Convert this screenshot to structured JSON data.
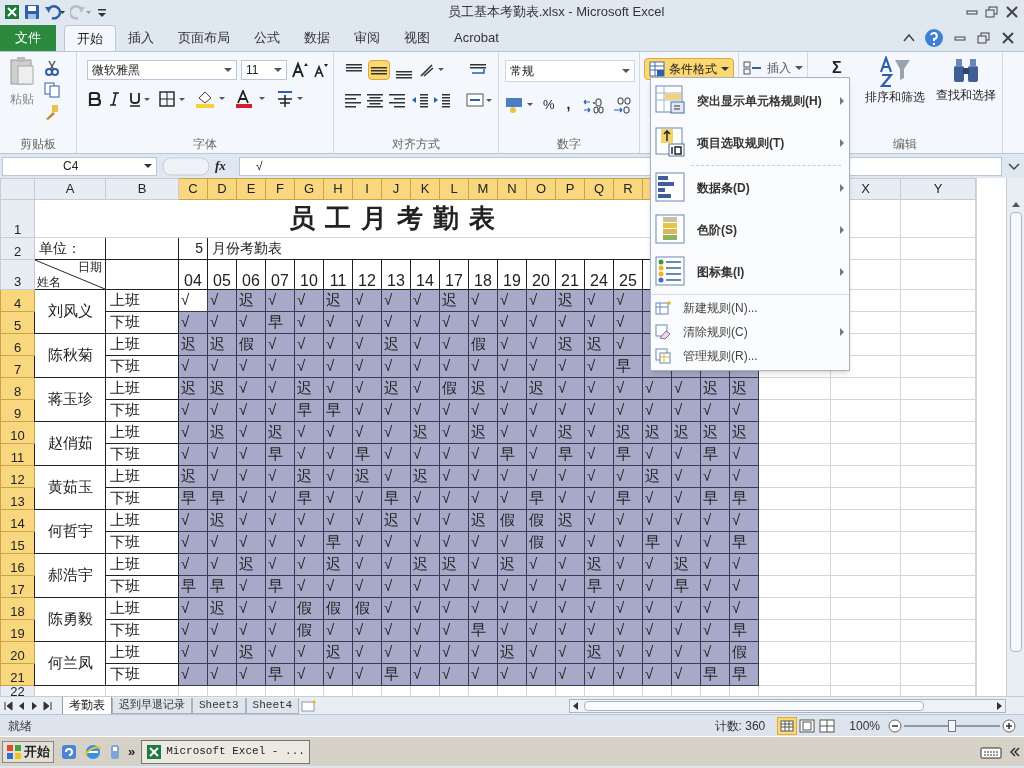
{
  "title_bar": {
    "title": "员工基本考勤表.xlsx - Microsoft Excel"
  },
  "ribbon_tabs": [
    {
      "label": "文件",
      "kind": "file",
      "selected": false
    },
    {
      "label": "开始",
      "kind": "tab",
      "selected": true
    },
    {
      "label": "插入",
      "kind": "tab",
      "selected": false
    },
    {
      "label": "页面布局",
      "kind": "tab",
      "selected": false
    },
    {
      "label": "公式",
      "kind": "tab",
      "selected": false
    },
    {
      "label": "数据",
      "kind": "tab",
      "selected": false
    },
    {
      "label": "审阅",
      "kind": "tab",
      "selected": false
    },
    {
      "label": "视图",
      "kind": "tab",
      "selected": false
    },
    {
      "label": "Acrobat",
      "kind": "tab",
      "selected": false
    }
  ],
  "ribbon": {
    "clipboard": {
      "paste": "粘贴",
      "group": "剪贴板"
    },
    "font": {
      "name": "微软雅黑",
      "size": "11",
      "group": "字体"
    },
    "alignment": {
      "group": "对齐方式"
    },
    "number": {
      "format": "常规",
      "group": "数字",
      "percent": "%",
      "comma": ","
    },
    "conditional_format": "条件格式",
    "insert": "插入",
    "sum": "Σ",
    "editing": {
      "sort": "排序和筛选",
      "find": "查找和选择",
      "group": "编辑"
    }
  },
  "formula_bar": {
    "name_box": "C4",
    "fx": "fx",
    "formula": "√"
  },
  "columns": [
    {
      "label": "A",
      "selected": false
    },
    {
      "label": "B",
      "selected": false
    },
    {
      "label": "C",
      "selected": true
    },
    {
      "label": "D",
      "selected": true
    },
    {
      "label": "E",
      "selected": true
    },
    {
      "label": "F",
      "selected": true
    },
    {
      "label": "G",
      "selected": true
    },
    {
      "label": "H",
      "selected": true
    },
    {
      "label": "I",
      "selected": true
    },
    {
      "label": "J",
      "selected": true
    },
    {
      "label": "K",
      "selected": true
    },
    {
      "label": "L",
      "selected": true
    },
    {
      "label": "M",
      "selected": true
    },
    {
      "label": "N",
      "selected": true
    },
    {
      "label": "O",
      "selected": true
    },
    {
      "label": "P",
      "selected": true
    },
    {
      "label": "Q",
      "selected": true
    },
    {
      "label": "R",
      "selected": true
    }
  ],
  "columns_right": [
    {
      "label": "X",
      "selected": false
    },
    {
      "label": "Y",
      "selected": false
    }
  ],
  "row_headers": [
    {
      "label": "1",
      "selected": false
    },
    {
      "label": "2",
      "selected": false
    },
    {
      "label": "3",
      "selected": false
    },
    {
      "label": "4",
      "selected": true
    },
    {
      "label": "5",
      "selected": true
    },
    {
      "label": "6",
      "selected": true
    },
    {
      "label": "7",
      "selected": true
    },
    {
      "label": "8",
      "selected": true
    },
    {
      "label": "9",
      "selected": true
    },
    {
      "label": "10",
      "selected": true
    },
    {
      "label": "11",
      "selected": true
    },
    {
      "label": "12",
      "selected": true
    },
    {
      "label": "13",
      "selected": true
    },
    {
      "label": "14",
      "selected": true
    },
    {
      "label": "15",
      "selected": true
    },
    {
      "label": "16",
      "selected": true
    },
    {
      "label": "17",
      "selected": true
    },
    {
      "label": "18",
      "selected": true
    },
    {
      "label": "19",
      "selected": true
    },
    {
      "label": "20",
      "selected": true
    },
    {
      "label": "21",
      "selected": true
    },
    {
      "label": "22",
      "selected": false
    }
  ],
  "sheet": {
    "title": "员工月考勤表",
    "unit_label": "单位：",
    "month": "5",
    "month_suffix": "月份考勤表",
    "corner_top": "日期",
    "corner_bottom": "姓名",
    "dates": [
      "04",
      "05",
      "06",
      "07",
      "10",
      "11",
      "12",
      "13",
      "14",
      "17",
      "18",
      "19",
      "20",
      "21",
      "24",
      "25"
    ],
    "employees": [
      {
        "name": "刘风义",
        "shifts": [
          {
            "label": "上班",
            "cells": [
              {
                "text": "√",
                "selected": true
              },
              "√",
              "迟",
              "√",
              "√",
              "迟",
              "√",
              "√",
              "√",
              "迟",
              "√",
              "√",
              "√",
              "迟",
              "√",
              "√"
            ]
          },
          {
            "label": "下班",
            "cells": [
              "√",
              "√",
              "√",
              "早",
              "√",
              "√",
              "√",
              "√",
              "√",
              "√",
              "√",
              "√",
              "√",
              "√",
              "√",
              "√"
            ]
          }
        ]
      },
      {
        "name": "陈秋菊",
        "shifts": [
          {
            "label": "上班",
            "cells": [
              "迟",
              "迟",
              "假",
              "√",
              "√",
              "√",
              "√",
              "迟",
              "√",
              "√",
              "假",
              "√",
              "√",
              "迟",
              "迟",
              "√"
            ]
          },
          {
            "label": "下班",
            "cells": [
              "√",
              "√",
              "√",
              "√",
              "√",
              "√",
              "√",
              "√",
              "√",
              "√",
              "√",
              "√",
              "√",
              "√",
              "√",
              "早"
            ]
          }
        ]
      },
      {
        "name": "蒋玉珍",
        "shifts": [
          {
            "label": "上班",
            "cells": [
              "迟",
              "迟",
              "√",
              "√",
              "迟",
              "√",
              "√",
              "迟",
              "√",
              "假",
              "迟",
              "√",
              "迟",
              "√",
              "√",
              "√",
              "√",
              "√",
              "迟",
              "迟"
            ]
          },
          {
            "label": "下班",
            "cells": [
              "√",
              "√",
              "√",
              "√",
              "早",
              "早",
              "√",
              "√",
              "√",
              "√",
              "√",
              "√",
              "√",
              "√",
              "√",
              "√",
              "√",
              "√",
              "√",
              "√"
            ]
          }
        ]
      },
      {
        "name": "赵俏茹",
        "shifts": [
          {
            "label": "上班",
            "cells": [
              "√",
              "迟",
              "√",
              "迟",
              "√",
              "√",
              "√",
              "√",
              "迟",
              "√",
              "迟",
              "√",
              "√",
              "迟",
              "√",
              "迟",
              "迟",
              "迟",
              "迟",
              "迟"
            ]
          },
          {
            "label": "下班",
            "cells": [
              "√",
              "√",
              "√",
              "早",
              "√",
              "√",
              "早",
              "√",
              "√",
              "√",
              "√",
              "早",
              "√",
              "早",
              "√",
              "早",
              "√",
              "√",
              "早",
              "√"
            ]
          }
        ]
      },
      {
        "name": "黄茹玉",
        "shifts": [
          {
            "label": "上班",
            "cells": [
              "迟",
              "√",
              "√",
              "√",
              "迟",
              "√",
              "迟",
              "√",
              "迟",
              "√",
              "√",
              "√",
              "√",
              "√",
              "√",
              "√",
              "迟",
              "√",
              "√",
              "√"
            ]
          },
          {
            "label": "下班",
            "cells": [
              "早",
              "早",
              "√",
              "√",
              "早",
              "√",
              "√",
              "早",
              "√",
              "√",
              "√",
              "√",
              "早",
              "√",
              "√",
              "早",
              "√",
              "√",
              "早",
              "早"
            ]
          }
        ]
      },
      {
        "name": "何哲宇",
        "shifts": [
          {
            "label": "上班",
            "cells": [
              "√",
              "迟",
              "√",
              "√",
              "√",
              "√",
              "√",
              "迟",
              "√",
              "√",
              "迟",
              "假",
              "假",
              "迟",
              "√",
              "√",
              "√",
              "√",
              "√",
              "√"
            ]
          },
          {
            "label": "下班",
            "cells": [
              "√",
              "√",
              "√",
              "√",
              "√",
              "早",
              "√",
              "√",
              "√",
              "√",
              "√",
              "√",
              "假",
              "√",
              "√",
              "√",
              "早",
              "√",
              "√",
              "早"
            ]
          }
        ]
      },
      {
        "name": "郝浩宇",
        "shifts": [
          {
            "label": "上班",
            "cells": [
              "√",
              "√",
              "迟",
              "√",
              "√",
              "迟",
              "√",
              "√",
              "迟",
              "迟",
              "√",
              "迟",
              "√",
              "√",
              "迟",
              "√",
              "√",
              "迟",
              "√",
              "√"
            ]
          },
          {
            "label": "下班",
            "cells": [
              "早",
              "早",
              "√",
              "早",
              "√",
              "√",
              "√",
              "√",
              "√",
              "√",
              "√",
              "√",
              "√",
              "√",
              "早",
              "√",
              "√",
              "早",
              "√",
              "√"
            ]
          }
        ]
      },
      {
        "name": "陈勇毅",
        "shifts": [
          {
            "label": "上班",
            "cells": [
              "√",
              "迟",
              "√",
              "√",
              "假",
              "假",
              "假",
              "√",
              "√",
              "√",
              "√",
              "√",
              "√",
              "√",
              "√",
              "√",
              "√",
              "√",
              "√",
              "√"
            ]
          },
          {
            "label": "下班",
            "cells": [
              "√",
              "√",
              "√",
              "√",
              "假",
              "√",
              "√",
              "√",
              "√",
              "√",
              "早",
              "√",
              "√",
              "√",
              "√",
              "√",
              "√",
              "√",
              "√",
              "早"
            ]
          }
        ]
      },
      {
        "name": "何兰凤",
        "shifts": [
          {
            "label": "上班",
            "cells": [
              "√",
              "√",
              "迟",
              "√",
              "√",
              "迟",
              "√",
              "√",
              "√",
              "√",
              "√",
              "迟",
              "√",
              "√",
              "迟",
              "√",
              "√",
              "√",
              "√",
              "假"
            ]
          },
          {
            "label": "下班",
            "cells": [
              "√",
              "√",
              "√",
              "早",
              "√",
              "√",
              "√",
              "早",
              "√",
              "√",
              "√",
              "√",
              "√",
              "√",
              "√",
              "√",
              "√",
              "√",
              "早",
              "早"
            ]
          }
        ]
      }
    ]
  },
  "conditional_format_menu": [
    {
      "label": "突出显示单元格规则(H)",
      "kind": "large",
      "submenu": true
    },
    {
      "label": "项目选取规则(T)",
      "kind": "large",
      "submenu": true
    },
    {
      "label": "数据条(D)",
      "kind": "large",
      "submenu": true
    },
    {
      "label": "色阶(S)",
      "kind": "large",
      "submenu": true
    },
    {
      "label": "图标集(I)",
      "kind": "large",
      "submenu": true
    },
    {
      "label": "新建规则(N)...",
      "kind": "small",
      "submenu": false
    },
    {
      "label": "清除规则(C)",
      "kind": "small",
      "submenu": true
    },
    {
      "label": "管理规则(R)...",
      "kind": "small",
      "submenu": false
    }
  ],
  "sheet_tabs": [
    {
      "label": "考勤表",
      "selected": true
    },
    {
      "label": "迟到早退记录",
      "selected": false
    },
    {
      "label": "Sheet3",
      "selected": false
    },
    {
      "label": "Sheet4",
      "selected": false
    }
  ],
  "status_bar": {
    "ready": "就绪",
    "count": "计数: 360",
    "zoom": "100%",
    "zoom_slider": {
      "level": 0.5
    }
  },
  "taskbar": {
    "start": "开始",
    "more": "»",
    "task": "Microsoft Excel - ..."
  }
}
